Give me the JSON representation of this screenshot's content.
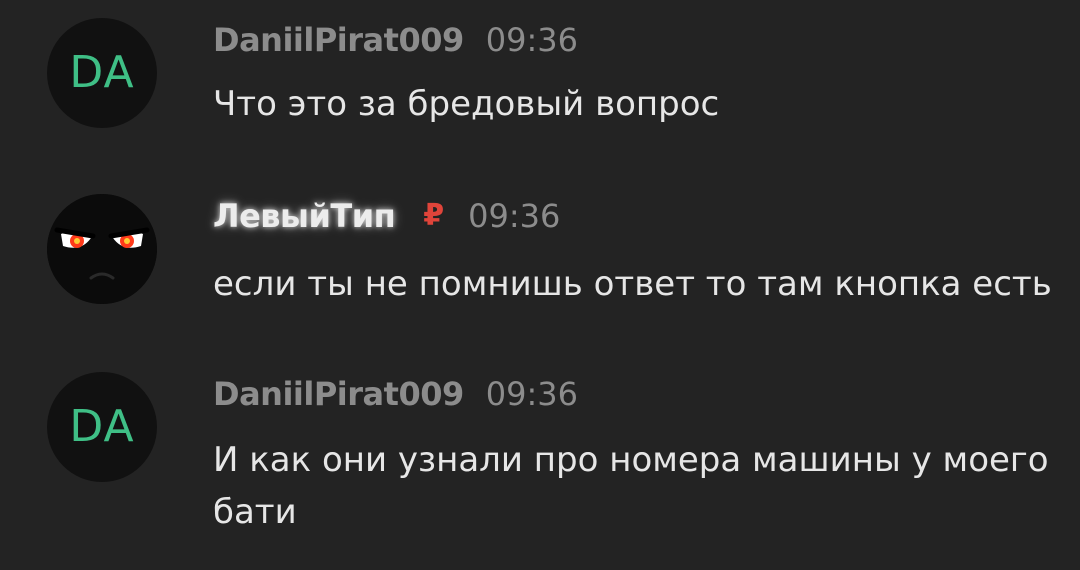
{
  "messages": [
    {
      "avatar_initials": "DA",
      "username": "DaniilPirat009",
      "timestamp": "09:36",
      "text": "Что это за бредовый вопрос"
    },
    {
      "avatar_icon": "angry-face-avatar",
      "username": "ЛевыйТип",
      "badge": "₽",
      "timestamp": "09:36",
      "text": "если ты не помнишь ответ то там кнопка есть"
    },
    {
      "avatar_initials": "DA",
      "username": "DaniilPirat009",
      "timestamp": "09:36",
      "text": "И как они узнали про номера машины у моего бати"
    }
  ],
  "colors": {
    "background": "#232323",
    "initials": "#3fbf86",
    "badge": "#e0443a",
    "muted_text": "#8c8c8c",
    "message_text": "#e6e6e6"
  }
}
